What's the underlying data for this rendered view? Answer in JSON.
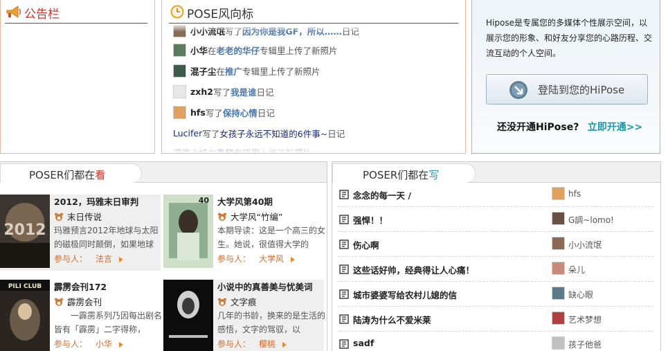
{
  "notice": {
    "title": "公告栏",
    "icon": "megaphone-icon"
  },
  "feed": {
    "title": "POSE风向标",
    "icon": "clock-icon",
    "items": [
      {
        "user": "小小流氓",
        "prefix": "写了",
        "link": "因为你是我GF，所以……",
        "suffix": "日记",
        "avatar": "#8a6a55"
      },
      {
        "user": "小华",
        "prefix": "在",
        "link": "老老的华仔",
        "suffix": "专辑里上传了新照片",
        "avatar": "#5b7a5e"
      },
      {
        "user": "混子尘",
        "prefix": "在",
        "link": "推广",
        "suffix": "专辑里上传了新照片",
        "avatar": "#3e5a4a"
      },
      {
        "user": "zxh2",
        "prefix": "写了",
        "link": "我是谁",
        "suffix": "日记",
        "avatar": "#dcdcdc"
      },
      {
        "user": "hfs",
        "prefix": "写了",
        "link": "保持心情",
        "suffix": "日记",
        "avatar": "#e0a060"
      },
      {
        "user": "Lucifer",
        "prefix": "写了",
        "link": "女孩子永远不知道的6件事~",
        "suffix": "日记",
        "avatar": ""
      },
      {
        "user": "浮游小妖",
        "prefix": "在",
        "link": "素颜",
        "suffix": "专辑里上传了新照片",
        "avatar": ""
      }
    ]
  },
  "login": {
    "intro": "Hipose是专属您的多媒体个性展示空间，以展示您的形象、和好友分享您的心路历程、交流互动的个人空间。",
    "button_label": "登陆到您的HiPose",
    "button_icon": "arrow-circle-icon",
    "signup_question": "还没开通HiPose?",
    "signup_link": "立即开通>>"
  },
  "reading": {
    "title_prefix": "POSER们都在",
    "title_accent": "看",
    "books": [
      {
        "title": "2012，玛雅末日审判",
        "source": "末日传说",
        "desc": "玛雅预言2012年地球与太阳的磁极同时颠倒，如果地球",
        "participants_label": "参与人：",
        "participants": "法言",
        "cover_text": "2012"
      },
      {
        "title": "大学风第40期",
        "source": "大学风“竹编”",
        "desc": "本期导读：这是一个高三的女生。她说，很值得大学的",
        "participants_label": "参与人：",
        "participants": "大学风",
        "cover_text": "40"
      },
      {
        "title": "霹雳会刊172",
        "source": "霹雳会刊",
        "desc": "一霹雳系列乃因每出剧名皆有「霹雳」二字得称，",
        "participants_label": "参与人：",
        "participants": "小华",
        "cover_text": "PILI CLUB"
      },
      {
        "title": "小说中的真善美与忧美词",
        "source": "文字痕",
        "desc": "几年的书龄，换来的是生活的感悟，文字的驾驭，以",
        "participants_label": "参与人：",
        "participants": "樱桃",
        "cover_text": ""
      }
    ]
  },
  "writing": {
    "title_prefix": "POSER们都在",
    "title_accent": "写",
    "entries": [
      {
        "title": "念念的每一天 /",
        "author": "hfs",
        "avatar": "#e0a060"
      },
      {
        "title": "强悍！！",
        "author": "G調~lomo!",
        "avatar": "#6a5040"
      },
      {
        "title": "伤心啊",
        "author": "小小流氓",
        "avatar": "#8a6a55"
      },
      {
        "title": "这些话好帅，经典得让人心痛！",
        "author": "朵儿",
        "avatar": "#c98a7a"
      },
      {
        "title": "城市婆婆写给农村儿媳的信",
        "author": "缺心眼",
        "avatar": "#5a7a8a"
      },
      {
        "title": "陆涛为什么不爱米莱",
        "author": "艺术梦想",
        "avatar": "#b04040"
      },
      {
        "title": "sadf",
        "author": "孩子他爸",
        "avatar": "#c0c0c0"
      }
    ]
  }
}
